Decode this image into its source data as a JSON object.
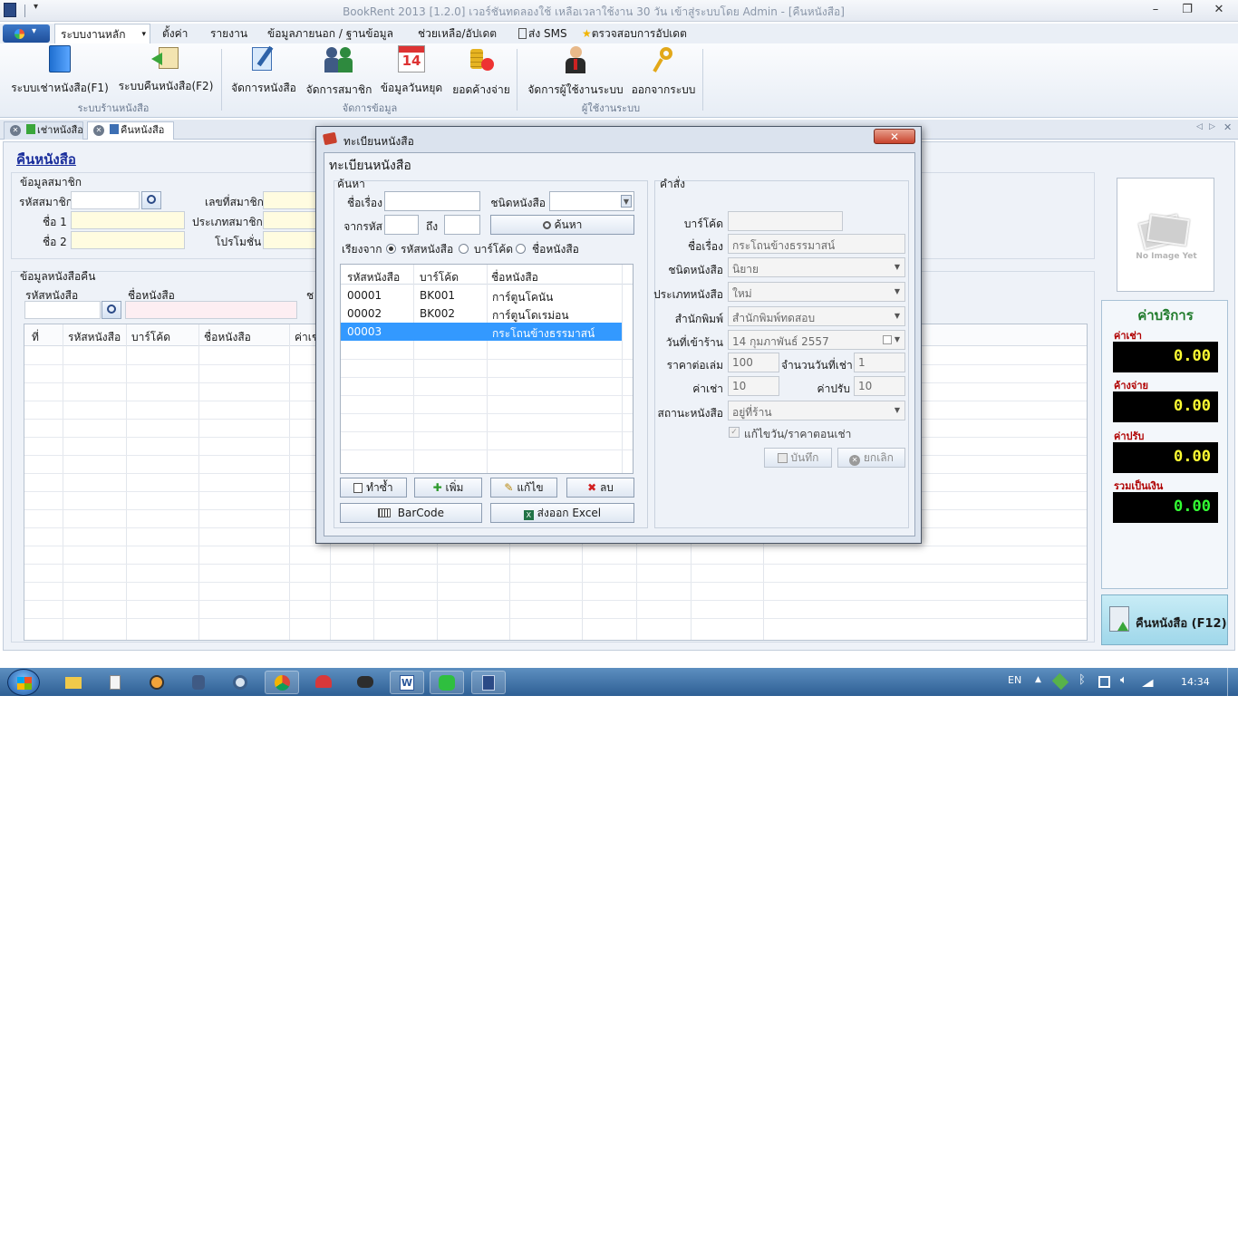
{
  "window": {
    "title": "BookRent 2013 [1.2.0] เวอร์ชันทดลองใช้ เหลือเวลาใช้งาน 30 วัน เข้าสู่ระบบโดย Admin - [คืนหนังสือ]",
    "minimize": "–",
    "restore": "❐",
    "close": "✕"
  },
  "menu": {
    "items": [
      "ระบบงานหลัก",
      "ตั้งค่า",
      "รายงาน",
      "ข้อมูลภายนอก / ฐานข้อมูล",
      "ช่วยเหลือ/อัปเดต",
      "ส่ง SMS",
      "ตรวจสอบการอัปเดต"
    ],
    "dropdown_glyph": "▾"
  },
  "ribbon": {
    "buttons": [
      "ระบบเช่าหนังสือ(F1)",
      "ระบบคืนหนังสือ(F2)",
      "จัดการหนังสือ",
      "จัดการสมาชิก",
      "ข้อมูลวันหยุด",
      "ยอดค้างจ่าย",
      "จัดการผู้ใช้งานระบบ",
      "ออกจากระบบ"
    ],
    "calendar_number": "14",
    "groups": [
      "ระบบร้านหนังสือ",
      "จัดการข้อมูล",
      "ผู้ใช้งานระบบ"
    ]
  },
  "tabs": [
    "เช่าหนังสือ",
    "คืนหนังสือ"
  ],
  "tab_nav": [
    "◁",
    "▷",
    "✕"
  ],
  "page": {
    "title": "คืนหนังสือ",
    "member_section": "ข้อมูลสมาชิก",
    "member_labels": [
      "รหัสสมาชิก",
      "ชื่อ 1",
      "ชื่อ 2",
      "เลขที่สมาชิก",
      "ประเภทสมาชิก",
      "โปรโมชั่น"
    ],
    "book_section": "ข้อมูลหนังสือคืน",
    "book_labels": [
      "รหัสหนังสือ",
      "ชื่อหนังสือ",
      "ช"
    ],
    "grid_headers": [
      "ที่",
      "รหัสหนังสือ",
      "บาร์โค้ด",
      "ชื่อหนังสือ",
      "ค่าเช"
    ]
  },
  "no_image": "No Image Yet",
  "fees": {
    "title": "ค่าบริการ",
    "items": [
      {
        "label": "ค่าเช่า",
        "value": "0.00"
      },
      {
        "label": "ค้างจ่าย",
        "value": "0.00"
      },
      {
        "label": "ค่าปรับ",
        "value": "0.00"
      },
      {
        "label": "รวมเป็นเงิน",
        "value": "0.00"
      }
    ]
  },
  "return_button": "คืนหนังสือ (F12)",
  "dialog": {
    "title": "ทะเบียนหนังสือ",
    "close": "✕",
    "heading": "ทะเบียนหนังสือ",
    "search": {
      "section": "ค้นหา",
      "title_label": "ชื่อเรื่อง",
      "type_label": "ชนิดหนังสือ",
      "from_label": "จากรหัส",
      "to_label": "ถึง",
      "search_button": "ค้นหา",
      "sort_label": "เรียงจาก",
      "sort_options": [
        "รหัสหนังสือ",
        "บาร์โค้ด",
        "ชื่อหนังสือ"
      ],
      "sort_selected": 0
    },
    "list": {
      "headers": [
        "รหัสหนังสือ",
        "บาร์โค้ด",
        "ชื่อหนังสือ"
      ],
      "rows": [
        {
          "code": "00001",
          "barcode": "BK001",
          "name": "การ์ตูนโคนัน"
        },
        {
          "code": "00002",
          "barcode": "BK002",
          "name": "การ์ตูนโดเรม่อน"
        },
        {
          "code": "00003",
          "barcode": "",
          "name": "กระโถนข้างธรรมาสน์"
        }
      ],
      "selected": 2
    },
    "actions": [
      "ทำซ้ำ",
      "เพิ่ม",
      "แก้ไข",
      "ลบ",
      "BarCode",
      "ส่งออก Excel"
    ],
    "command": {
      "section": "คำสั่ง",
      "labels": {
        "barcode": "บาร์โค้ด",
        "title": "ชื่อเรื่อง",
        "type": "ชนิดหนังสือ",
        "category": "ประเภทหนังสือ",
        "publisher": "สำนักพิมพ์",
        "date_in": "วันที่เข้าร้าน",
        "price": "ราคาต่อเล่ม",
        "rent_days": "จำนวนวันที่เช่า",
        "rent_fee": "ค่าเช่า",
        "fine": "ค่าปรับ",
        "status": "สถานะหนังสือ",
        "edit_price": "แก้ไขวัน/ราคาตอนเช่า"
      },
      "values": {
        "barcode": "",
        "title": "กระโถนข้างธรรมาสน์",
        "type": "นิยาย",
        "category": "ใหม่",
        "publisher": "สำนักพิมพ์ทดสอบ",
        "date_in": "14  กุมภาพันธ์   2557",
        "price": "100",
        "rent_days": "1",
        "rent_fee": "10",
        "fine": "10",
        "status": "อยู่ที่ร้าน"
      },
      "save": "บันทึก",
      "cancel": "ยกเลิก"
    }
  },
  "taskbar": {
    "lang": "EN",
    "time": "14:34"
  },
  "colors": {
    "selected_row": "#3399ff",
    "fee_value": "#ffff33",
    "fee_total": "#33ff33",
    "fee_label": "#b00000",
    "fee_title": "#1e7a2a",
    "page_title": "#1a2e9c"
  }
}
